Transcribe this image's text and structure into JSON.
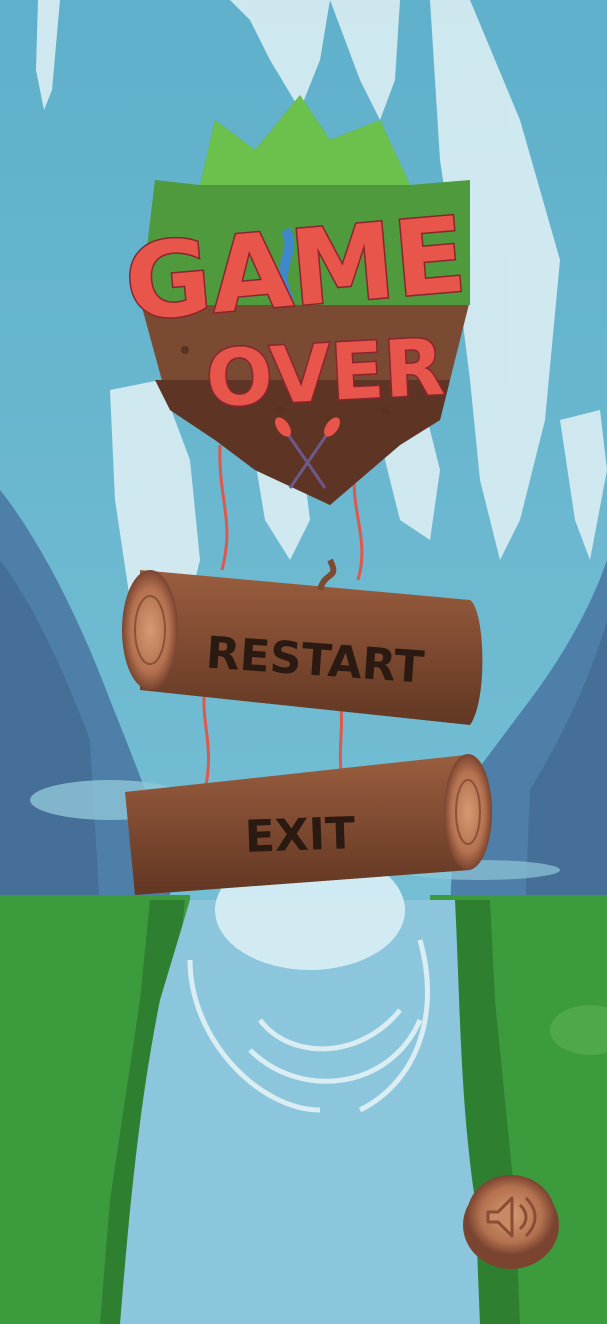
{
  "screen": "game-over",
  "title": {
    "line1": "GAME",
    "line2": "OVER"
  },
  "buttons": {
    "restart": "RESTART",
    "exit": "EXIT"
  },
  "sound_button": {
    "icon": "speaker-sound-icon",
    "state": "on"
  },
  "colors": {
    "sky": "#6cb7cf",
    "waterfall": "#d9ecf2",
    "mountain": "#4e7fa8",
    "grass": "#3c9b3d",
    "river": "#8cc6dc",
    "title_red": "#e8554a",
    "wood": "#8a5136",
    "wood_dark": "#5e3322"
  }
}
